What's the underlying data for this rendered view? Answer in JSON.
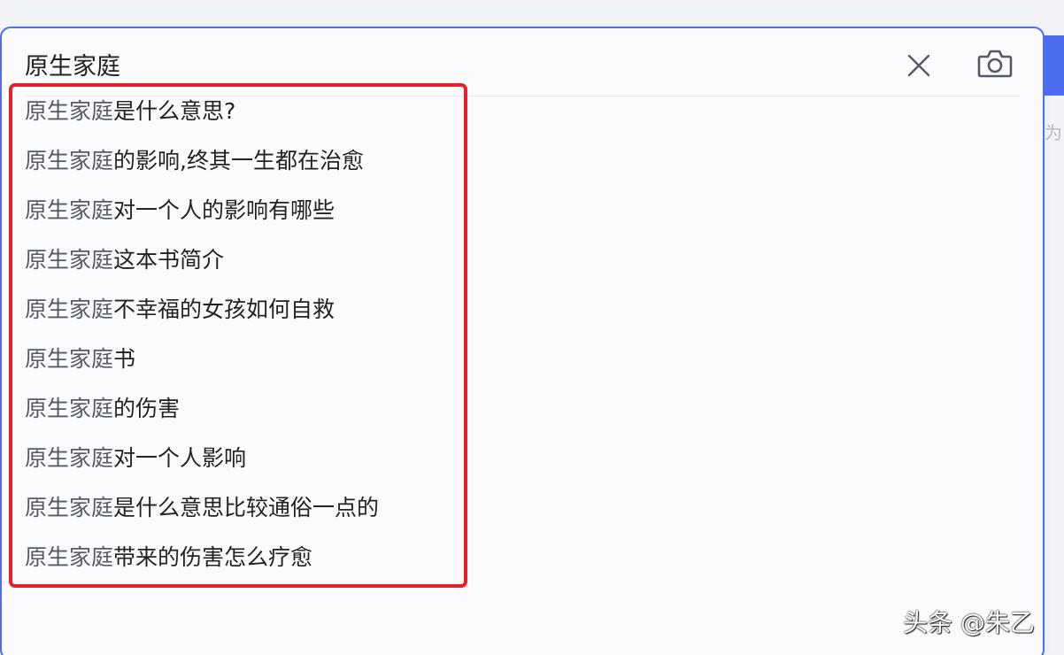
{
  "search": {
    "query": "原生家庭",
    "clear_icon": "close-icon",
    "camera_icon": "camera-icon",
    "accent_color": "#4e6ef2"
  },
  "suggestions": [
    {
      "prefix": "原生家庭",
      "suffix": "是什么意思?"
    },
    {
      "prefix": "原生家庭",
      "suffix": "的影响,终其一生都在治愈"
    },
    {
      "prefix": "原生家庭",
      "suffix": "对一个人的影响有哪些"
    },
    {
      "prefix": "原生家庭",
      "suffix": "这本书简介"
    },
    {
      "prefix": "原生家庭",
      "suffix": "不幸福的女孩如何自救"
    },
    {
      "prefix": "原生家庭",
      "suffix": "书"
    },
    {
      "prefix": "原生家庭",
      "suffix": "的伤害"
    },
    {
      "prefix": "原生家庭",
      "suffix": "对一个人影响"
    },
    {
      "prefix": "原生家庭",
      "suffix": "是什么意思比较通俗一点的"
    },
    {
      "prefix": "原生家庭",
      "suffix": "带来的伤害怎么疗愈"
    }
  ],
  "highlight": {
    "box_color": "#e8202a"
  },
  "background": {
    "partial_text": "为"
  },
  "watermark": {
    "text": "头条 @朱乙"
  }
}
